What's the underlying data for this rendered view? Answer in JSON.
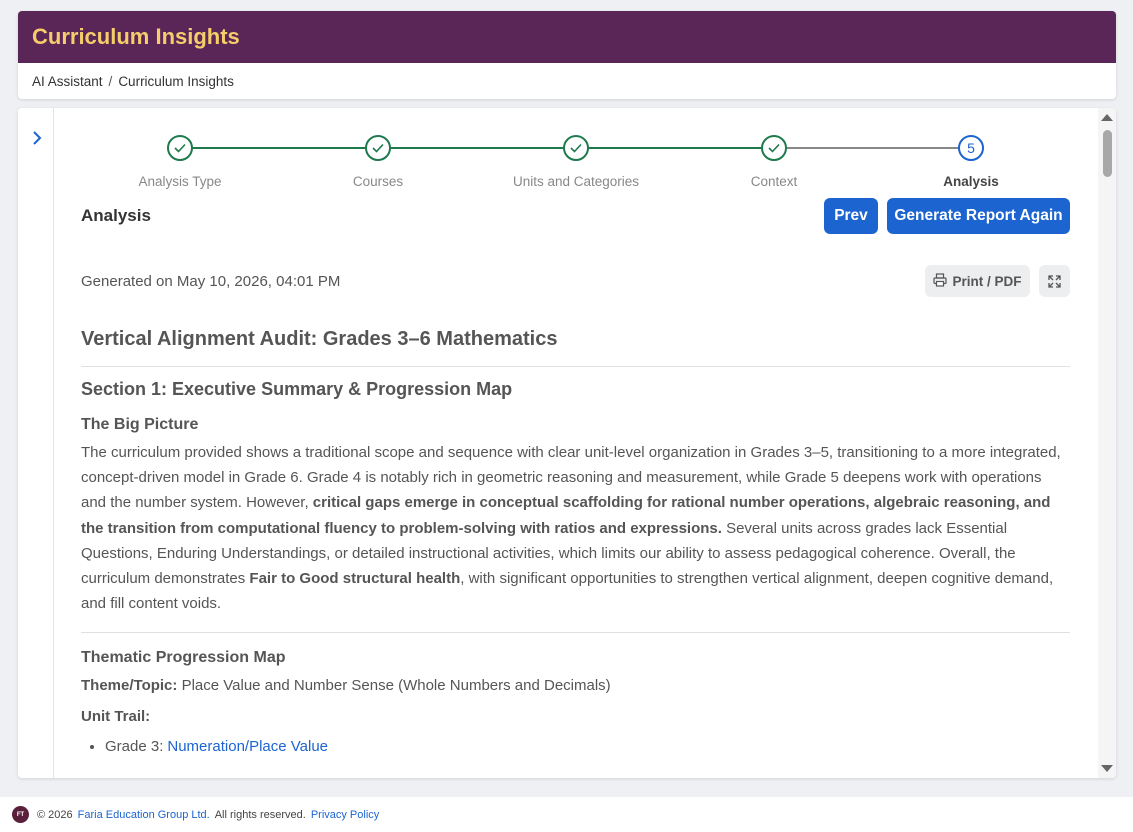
{
  "header": {
    "title": "Curriculum Insights",
    "breadcrumb": [
      "AI Assistant",
      "Curriculum Insights"
    ],
    "breadcrumb_sep": "/"
  },
  "stepper": {
    "steps": [
      {
        "label": "Analysis Type",
        "state": "done"
      },
      {
        "label": "Courses",
        "state": "done"
      },
      {
        "label": "Units and Categories",
        "state": "done"
      },
      {
        "label": "Context",
        "state": "done"
      },
      {
        "label": "Analysis",
        "state": "active",
        "number": "5"
      }
    ]
  },
  "toolbar": {
    "title": "Analysis",
    "prev_label": "Prev",
    "generate_label": "Generate Report Again",
    "generated_text": "Generated on May 10, 2026, 04:01 PM",
    "print_label": "Print / PDF"
  },
  "report": {
    "title": "Vertical Alignment Audit: Grades 3–6 Mathematics",
    "section1_title": "Section 1: Executive Summary & Progression Map",
    "big_picture_title": "The Big Picture",
    "p_part1": "The curriculum provided shows a traditional scope and sequence with clear unit-level organization in Grades 3–5, transitioning to a more integrated, concept-driven model in Grade 6. Grade 4 is notably rich in geometric reasoning and measurement, while Grade 5 deepens work with operations and the number system. However, ",
    "p_bold1": "critical gaps emerge in conceptual scaffolding for rational number operations, algebraic reasoning, and the transition from computational fluency to problem-solving with ratios and expressions.",
    "p_part2": " Several units across grades lack Essential Questions, Enduring Understandings, or detailed instructional activities, which limits our ability to assess pedagogical coherence. Overall, the curriculum demonstrates ",
    "p_bold2": "Fair to Good structural health",
    "p_part3": ", with significant opportunities to strengthen vertical alignment, deepen cognitive demand, and fill content voids.",
    "thematic_title": "Thematic Progression Map",
    "theme_label": "Theme/Topic:",
    "theme_value": " Place Value and Number Sense (Whole Numbers and Decimals)",
    "unit_trail_label": "Unit Trail:",
    "trail_items": [
      {
        "grade": "Grade 3:",
        "unit": "Numeration/Place Value"
      }
    ]
  },
  "footer": {
    "logo_text": "FT",
    "copyright": "© 2026",
    "company": "Faria Education Group Ltd.",
    "rights": "All rights reserved.",
    "privacy": "Privacy Policy"
  },
  "colors": {
    "header_bg": "#5a2657",
    "header_title": "#f5cd6a",
    "step_done": "#1f7a4d",
    "primary": "#1c64d0"
  },
  "icons": {
    "side_toggle": "chevron-right-icon",
    "step_done": "check-icon",
    "print": "printer-icon",
    "expand": "expand-icon"
  }
}
